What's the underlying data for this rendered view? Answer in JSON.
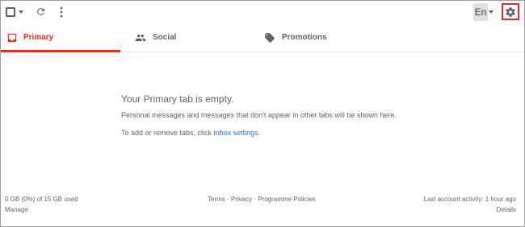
{
  "toolbar": {
    "select_icon": "checkbox-icon",
    "refresh_icon": "refresh-icon",
    "more_icon": "more-vert-icon",
    "language_label": "En",
    "settings_icon": "gear-icon",
    "settings_highlight_color": "#d93025"
  },
  "tabs": [
    {
      "label": "Primary",
      "icon": "inbox-icon",
      "active": true
    },
    {
      "label": "Social",
      "icon": "people-icon",
      "active": false
    },
    {
      "label": "Promotions",
      "icon": "tag-icon",
      "active": false
    }
  ],
  "empty_state": {
    "title": "Your Primary tab is empty.",
    "description": "Personal messages and messages that don't appear in other tabs will be shown here.",
    "tabs_prefix": "To add or remove tabs, click ",
    "tabs_link": "inbox settings",
    "tabs_suffix": "."
  },
  "footer": {
    "storage": "0 GB (0%) of 15 GB used",
    "manage": "Manage",
    "links": "Terms · Privacy · Programme Policies",
    "activity": "Last account activity: 1 hour ago",
    "details": "Details"
  },
  "colors": {
    "accent": "#d93025",
    "link": "#1a73e8",
    "text": "#5f6368"
  }
}
